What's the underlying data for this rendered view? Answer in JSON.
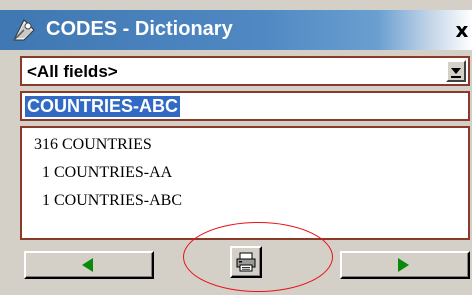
{
  "window": {
    "title": "CODES - Dictionary",
    "close_label": "x"
  },
  "field_filter": {
    "selected": "<All fields>"
  },
  "search": {
    "value": "COUNTRIES-ABC"
  },
  "results": [
    {
      "text": "   316 COUNTRIES"
    },
    {
      "text": "     1 COUNTRIES-AA"
    },
    {
      "text": "     1 COUNTRIES-ABC"
    }
  ],
  "icons": {
    "app": "codes-dictionary-icon",
    "dropdown": "chevron-down-icon",
    "prev": "arrow-left-icon",
    "print": "printer-icon",
    "next": "arrow-right-icon"
  },
  "colors": {
    "titlebar": "#4a84c0",
    "selection": "#316ac5",
    "field_border": "#8b3a2a",
    "arrow": "#0a8a0a",
    "annotation": "#e8121a"
  }
}
